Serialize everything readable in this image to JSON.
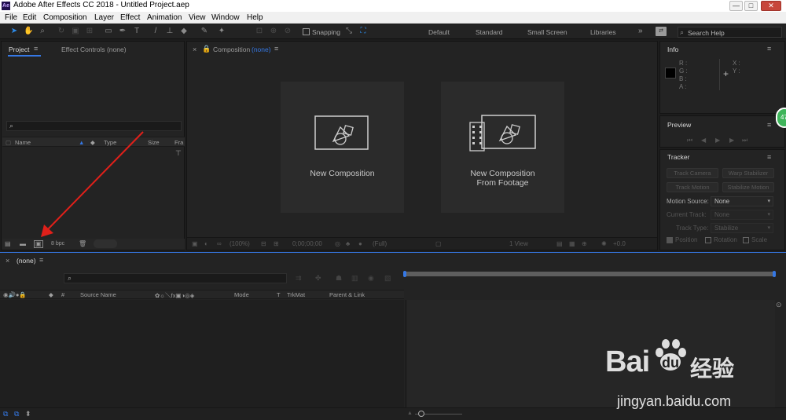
{
  "window": {
    "title": "Adobe After Effects CC 2018 - Untitled Project.aep",
    "logo_text": "Ae",
    "min": "—",
    "max": "□",
    "close": "✕"
  },
  "menu": [
    "File",
    "Edit",
    "Composition",
    "Layer",
    "Effect",
    "Animation",
    "View",
    "Window",
    "Help"
  ],
  "toolbar": {
    "snapping": "Snapping",
    "workspaces": [
      "Default",
      "Standard",
      "Small Screen",
      "Libraries"
    ],
    "more": "»",
    "search_placeholder": "Search Help"
  },
  "project_panel": {
    "tab_project": "Project",
    "tab_effect_controls": "Effect Controls (none)",
    "search_icon": "⌕",
    "columns": [
      "Name",
      "Type",
      "Size",
      "Fra"
    ],
    "bpc": "8 bpc"
  },
  "composition_panel": {
    "tab_label": "Composition",
    "tab_value": "(none)",
    "cards": [
      {
        "line1": "New Composition",
        "line2": ""
      },
      {
        "line1": "New Composition",
        "line2": "From Footage"
      }
    ],
    "bottom": {
      "zoom": "(100%)",
      "timecode": "0;00;00;00",
      "quality": "(Full)",
      "view": "1 View",
      "offset": "+0.0"
    }
  },
  "info_panel": {
    "title": "Info",
    "r": "R :",
    "g": "G :",
    "b": "B :",
    "a": "A :",
    "x": "X :",
    "y": "Y :"
  },
  "preview_panel": {
    "title": "Preview"
  },
  "tracker_panel": {
    "title": "Tracker",
    "track_camera": "Track Camera",
    "warp_stabilizer": "Warp Stabilizer",
    "track_motion": "Track Motion",
    "stabilize_motion": "Stabilize Motion",
    "motion_source_label": "Motion Source:",
    "motion_source_value": "None",
    "current_track_label": "Current Track:",
    "current_track_value": "None",
    "track_type_label": "Track Type:",
    "track_type_value": "Stabilize",
    "position": "Position",
    "rotation": "Rotation",
    "scale": "Scale"
  },
  "timeline": {
    "tab_label": "(none)",
    "columns": [
      "Source Name",
      "Mode",
      "T",
      "TrkMat",
      "Parent & Link"
    ],
    "num_col": "#"
  },
  "watermark": {
    "brand": "Bai",
    "brand2": "du",
    "cn": "经验",
    "url": "jingyan.baidu.com"
  },
  "badge": "47",
  "colors": {
    "accent": "#3578e5",
    "arrow": "#e0201a"
  }
}
